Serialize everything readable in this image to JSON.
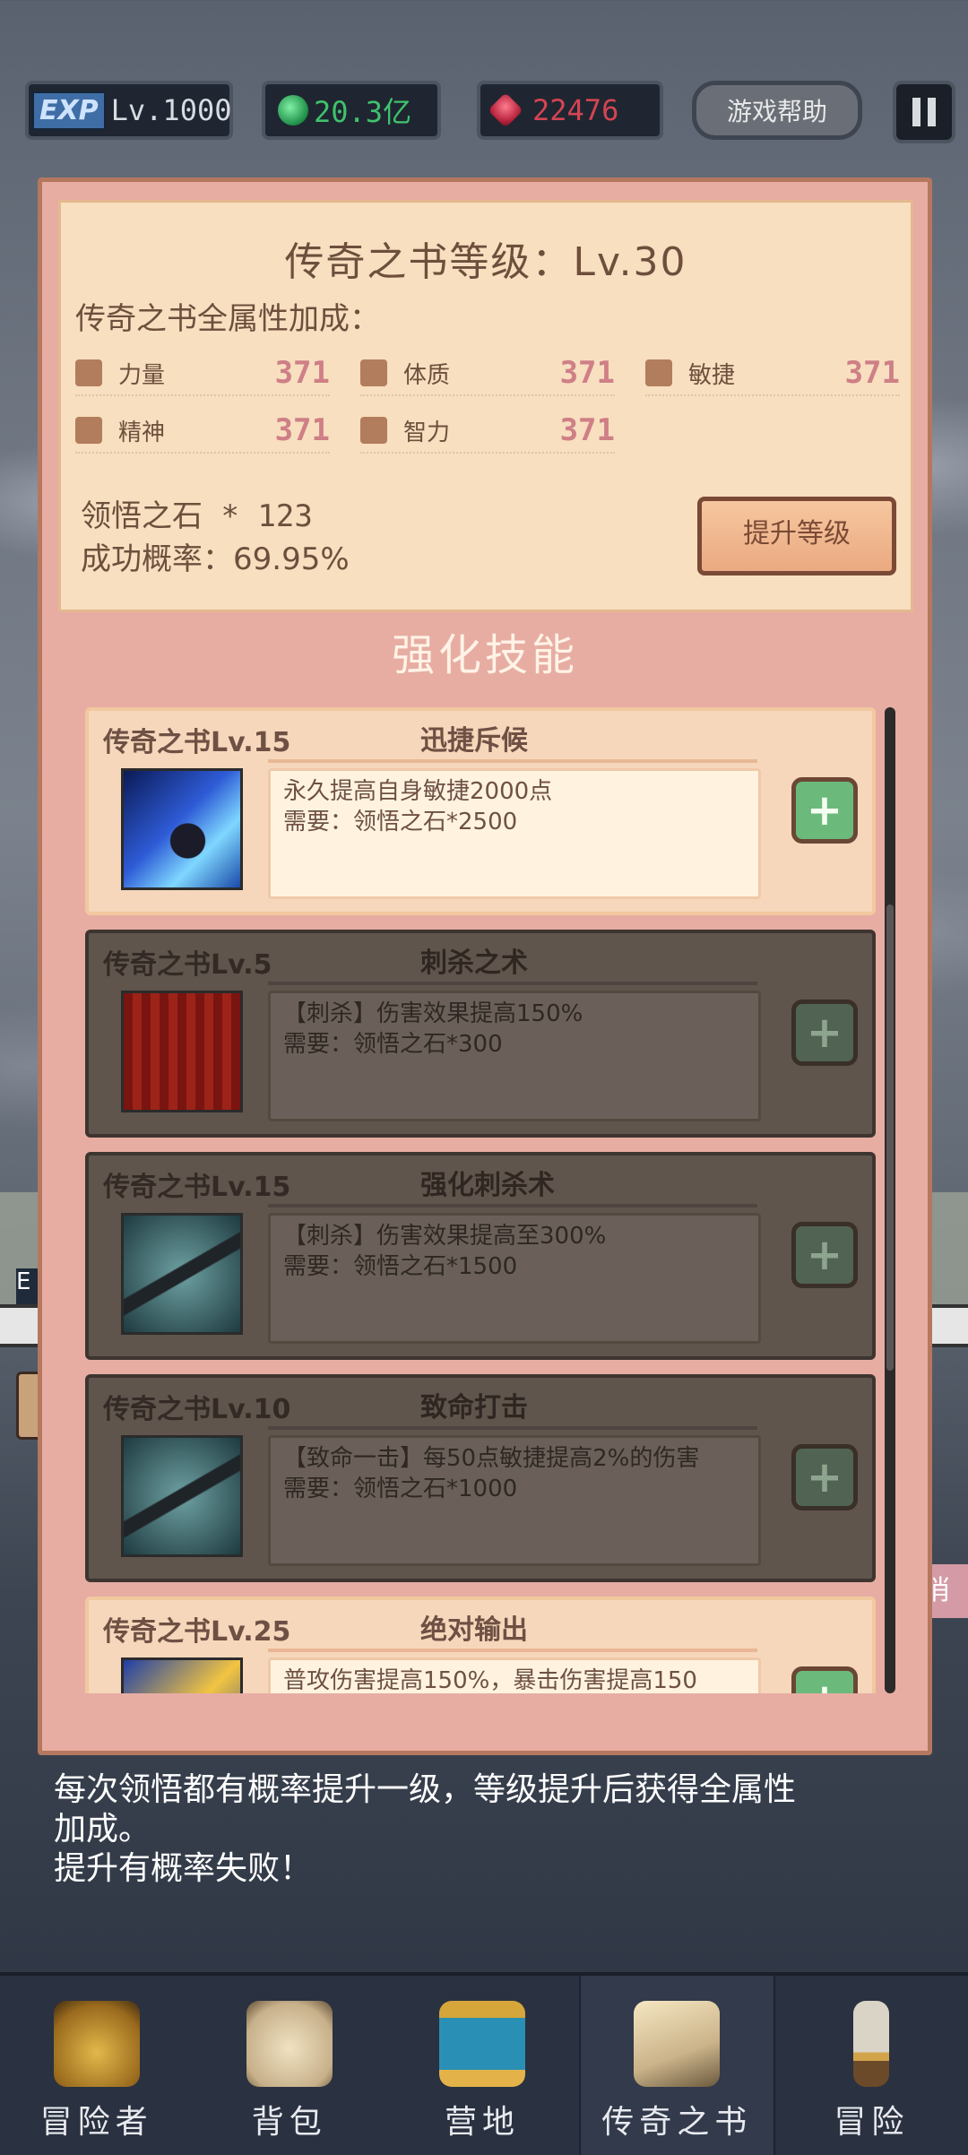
{
  "topbar": {
    "exp_badge": "EXP",
    "exp_level": "Lv.1000",
    "gold": "20.3亿",
    "gems": "22476",
    "help_label": "游戏帮助"
  },
  "book": {
    "title": "传奇之书等级：Lv.30",
    "subtitle": "传奇之书全属性加成：",
    "stats": [
      {
        "label": "力量",
        "value": "371"
      },
      {
        "label": "体质",
        "value": "371"
      },
      {
        "label": "敏捷",
        "value": "371"
      },
      {
        "label": "精神",
        "value": "371"
      },
      {
        "label": "智力",
        "value": "371"
      }
    ],
    "stone_count": "领悟之石 * 123",
    "success_rate": "成功概率：69.95%",
    "upgrade_label": "提升等级"
  },
  "section_title": "强化技能",
  "skills": [
    {
      "level": "传奇之书Lv.15",
      "name": "迅捷斥候",
      "desc": "永久提高自身敏捷2000点",
      "req": "需要：领悟之石*2500",
      "state": "enabled",
      "plus": "+"
    },
    {
      "level": "传奇之书Lv.5",
      "name": "刺杀之术",
      "desc": "【刺杀】伤害效果提高150%",
      "req": "需要：领悟之石*300",
      "state": "disabled",
      "plus": "+"
    },
    {
      "level": "传奇之书Lv.15",
      "name": "强化刺杀术",
      "desc": "【刺杀】伤害效果提高至300%",
      "req": "需要：领悟之石*1500",
      "state": "disabled",
      "plus": "+"
    },
    {
      "level": "传奇之书Lv.10",
      "name": "致命打击",
      "desc": "【致命一击】每50点敏捷提高2%的伤害",
      "req": "需要：领悟之石*1000",
      "state": "disabled",
      "plus": "+"
    },
    {
      "level": "传奇之书Lv.25",
      "name": "绝对输出",
      "desc": "普攻伤害提高150%，暴击伤害提高150",
      "req": "",
      "state": "enabled",
      "plus": "+"
    }
  ],
  "hint": {
    "line1": "每次领悟都有概率提升一级，等级提升后获得全属性",
    "line2": "加成。",
    "line3": "提升有概率失败！"
  },
  "nav": [
    {
      "label": "冒险者",
      "icon": "helmet-icon"
    },
    {
      "label": "背包",
      "icon": "backpack-icon"
    },
    {
      "label": "营地",
      "icon": "camp-banner-icon"
    },
    {
      "label": "传奇之书",
      "icon": "legend-book-icon"
    },
    {
      "label": "冒险",
      "icon": "sword-icon"
    }
  ],
  "bg_side_label": "E",
  "bg_right_chip": "消",
  "colors": {
    "modal_bg": "#e7ada3",
    "panel_bg": "#f7dfc0",
    "stat_value": "#cf7f86",
    "plus_enabled": "#6cb97c",
    "gold_text": "#3fc26d",
    "gem_text": "#d44452"
  }
}
